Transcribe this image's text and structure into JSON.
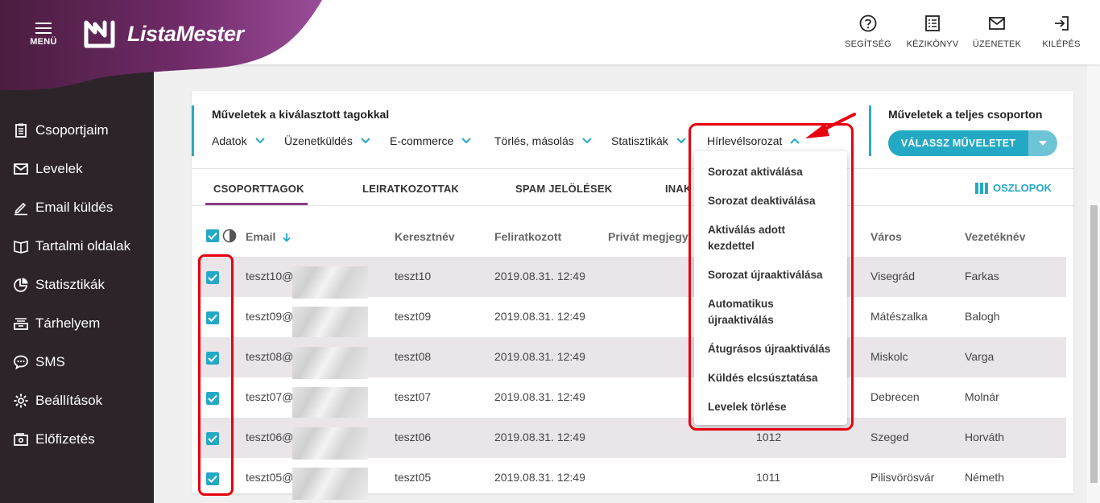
{
  "app": {
    "name": "ListaMester",
    "menu_label": "MENÜ"
  },
  "top_actions": [
    {
      "label": "SEGÍTSÉG",
      "icon": "help-icon"
    },
    {
      "label": "KÉZIKÖNYV",
      "icon": "manual-icon"
    },
    {
      "label": "ÜZENETEK",
      "icon": "mail-icon"
    },
    {
      "label": "KILÉPÉS",
      "icon": "logout-icon"
    }
  ],
  "sidebar": {
    "items": [
      {
        "label": "Csoportjaim",
        "icon": "clipboard-icon"
      },
      {
        "label": "Levelek",
        "icon": "envelope-icon"
      },
      {
        "label": "Email küldés",
        "icon": "pen-icon"
      },
      {
        "label": "Tartalmi oldalak",
        "icon": "book-icon"
      },
      {
        "label": "Statisztikák",
        "icon": "pie-chart-icon"
      },
      {
        "label": "Tárhelyem",
        "icon": "storage-icon"
      },
      {
        "label": "SMS",
        "icon": "sms-icon"
      },
      {
        "label": "Beállítások",
        "icon": "gear-icon"
      },
      {
        "label": "Előfizetés",
        "icon": "wallet-icon"
      }
    ]
  },
  "operations": {
    "selected_title": "Műveletek a kiválasztott tagokkal",
    "group_title": "Műveletek a teljes csoporton",
    "menus": [
      "Adatok",
      "Üzenetküldés",
      "E-commerce",
      "Törlés, másolás",
      "Statisztikák",
      "Hírlevélsorozat"
    ],
    "choose_action_label": "VÁLASSZ MŰVELETET"
  },
  "tabs": [
    "CSOPORTTAGOK",
    "LEIRATKOZOTTAK",
    "SPAM JELÖLÉSEK",
    "INAK"
  ],
  "columns_button": "OSZLOPOK",
  "table": {
    "headers": {
      "email": "Email",
      "first_name": "Keresztnév",
      "subscribed": "Feliratkozott",
      "private_note": "Privát megjegy",
      "city": "Város",
      "last_name": "Vezetéknév"
    },
    "rows": [
      {
        "email": "teszt10@",
        "first_name": "teszt10",
        "subscribed": "2019.08.31. 12:49",
        "id": "",
        "city": "Visegrád",
        "last_name": "Farkas"
      },
      {
        "email": "teszt09@",
        "first_name": "teszt09",
        "subscribed": "2019.08.31. 12:49",
        "id": "",
        "city": "Mátészalka",
        "last_name": "Balogh"
      },
      {
        "email": "teszt08@",
        "first_name": "teszt08",
        "subscribed": "2019.08.31. 12:49",
        "id": "",
        "city": "Miskolc",
        "last_name": "Varga"
      },
      {
        "email": "teszt07@",
        "first_name": "teszt07",
        "subscribed": "2019.08.31. 12:49",
        "id": "",
        "city": "Debrecen",
        "last_name": "Molnár"
      },
      {
        "email": "teszt06@",
        "first_name": "teszt06",
        "subscribed": "2019.08.31. 12:49",
        "id": "1012",
        "city": "Szeged",
        "last_name": "Horváth"
      },
      {
        "email": "teszt05@",
        "first_name": "teszt05",
        "subscribed": "2019.08.31. 12:49",
        "id": "1011",
        "city": "Pilisvörösvár",
        "last_name": "Németh"
      }
    ]
  },
  "dropdown": {
    "items": [
      "Sorozat aktiválása",
      "Sorozat deaktiválása",
      "Aktiválás adott kezdettel",
      "Sorozat újraaktiválása",
      "Automatikus újraaktiválás",
      "Átugrásos újraaktiválás",
      "Küldés elcsúsztatása",
      "Levelek törlése"
    ]
  },
  "colors": {
    "accent": "#24a9c4",
    "brand_purple": "#8c3a86",
    "sidebar_bg": "#2d2429",
    "highlight_red": "#e8000e"
  }
}
